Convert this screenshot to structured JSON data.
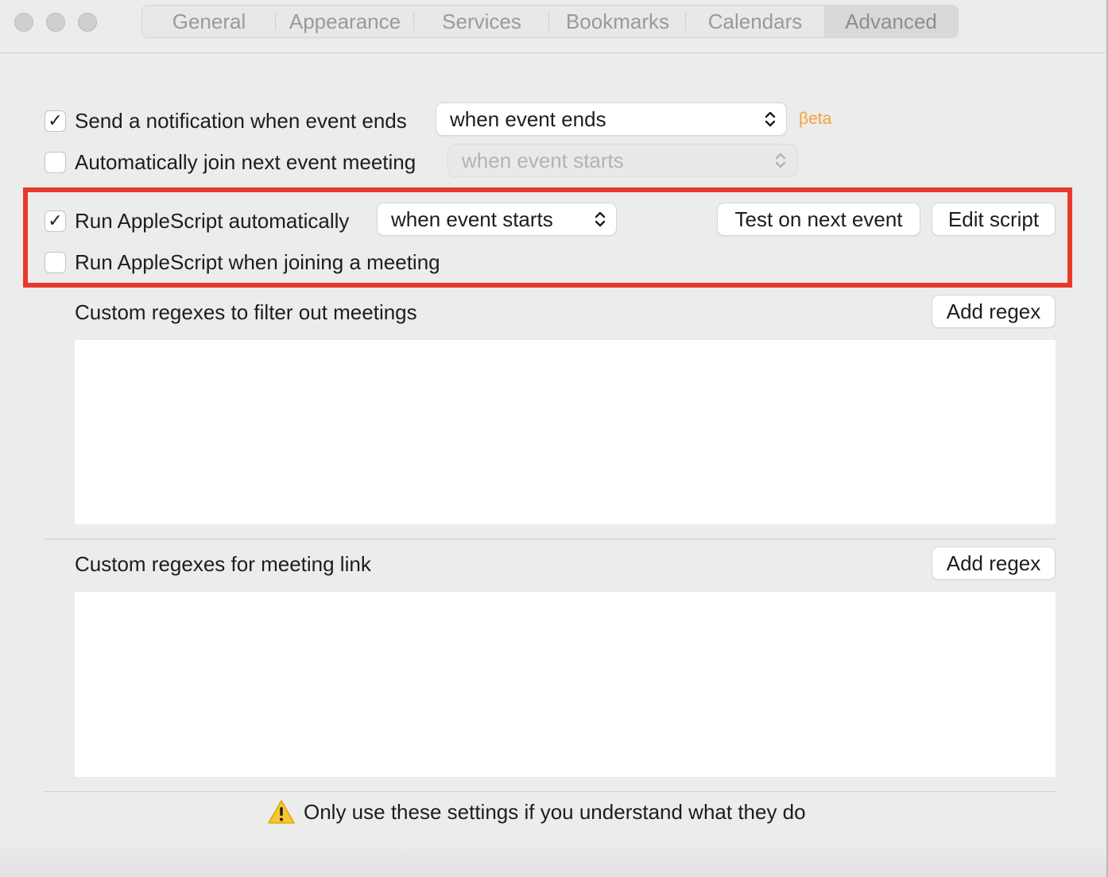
{
  "tabs": {
    "items": [
      {
        "label": "General"
      },
      {
        "label": "Appearance"
      },
      {
        "label": "Services"
      },
      {
        "label": "Bookmarks"
      },
      {
        "label": "Calendars"
      },
      {
        "label": "Advanced"
      }
    ],
    "active": "Advanced"
  },
  "notification": {
    "label": "Send a notification when event ends",
    "checked": true,
    "select_value": "when event ends",
    "badge": "βeta"
  },
  "auto_join": {
    "label": "Automatically join next event meeting",
    "checked": false,
    "select_value": "when event starts",
    "select_disabled": true
  },
  "applescript": {
    "auto_label": "Run AppleScript automatically",
    "auto_checked": true,
    "auto_select_value": "when event starts",
    "test_button": "Test on next event",
    "edit_button": "Edit script",
    "join_label": "Run AppleScript when joining a meeting",
    "join_checked": false
  },
  "filter_regexes": {
    "title": "Custom regexes to filter out meetings",
    "add_button": "Add regex",
    "items": []
  },
  "link_regexes": {
    "title": "Custom regexes for meeting link",
    "add_button": "Add regex",
    "items": []
  },
  "footer": {
    "warning": "Only use these settings if you understand what they do"
  },
  "colors": {
    "beta": "#f5a13a",
    "highlight": "#e8392a",
    "warning_icon": "#f7c531"
  },
  "icons": {
    "checkbox": "checkmark-icon",
    "select": "chevron-up-down-icon",
    "warning": "warning-triangle-icon"
  }
}
